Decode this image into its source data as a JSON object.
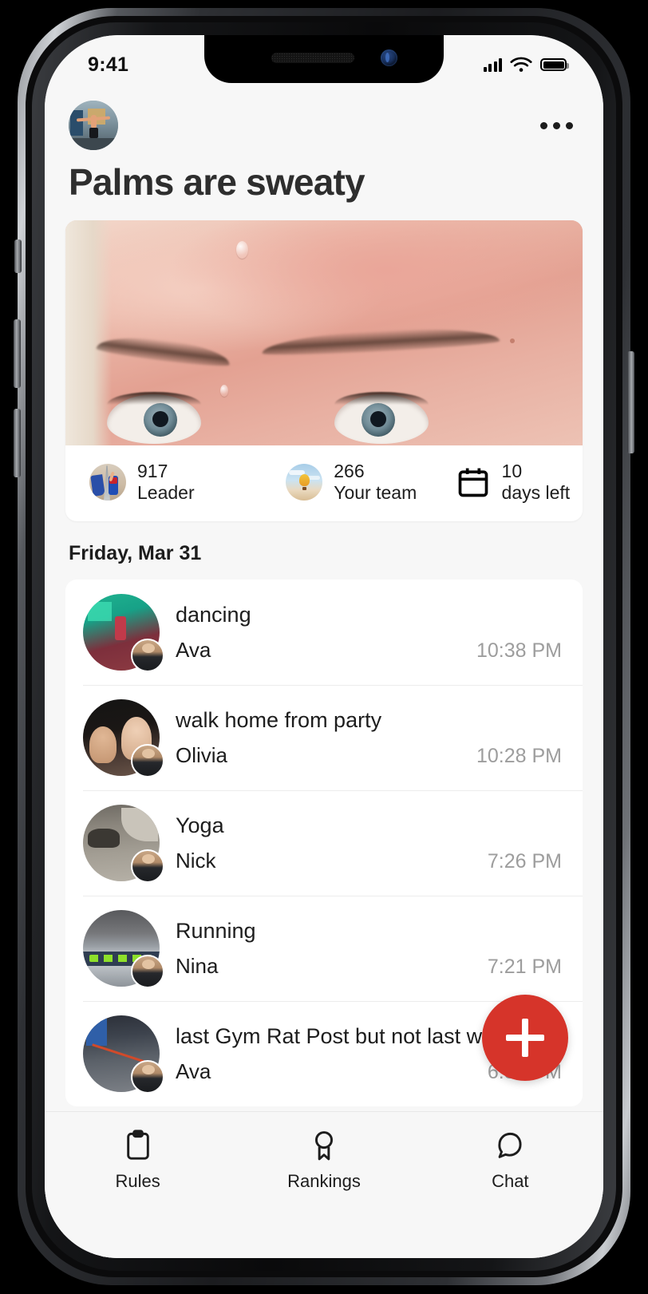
{
  "status_bar": {
    "time": "9:41",
    "signal_icon": "cellular-signal-icon",
    "wifi_icon": "wifi-icon",
    "battery_icon": "battery-full-icon"
  },
  "header": {
    "avatar_name": "group-avatar",
    "menu_icon": "more-options-icon",
    "title": "Palms are sweaty"
  },
  "hero": {
    "image_name": "sweaty-forehead-photo",
    "stats": [
      {
        "icon": "leader-avatar",
        "value": "917",
        "label": "Leader"
      },
      {
        "icon": "team-avatar",
        "value": "266",
        "label": "Your team"
      },
      {
        "icon": "calendar-icon",
        "value": "10",
        "label": "days left"
      }
    ]
  },
  "feed": {
    "date_header": "Friday, Mar 31",
    "items": [
      {
        "title": "dancing",
        "user": "Ava",
        "time": "10:38 PM",
        "photo": "pic-dance"
      },
      {
        "title": "walk home from party",
        "user": "Olivia",
        "time": "10:28 PM",
        "photo": "pic-walk"
      },
      {
        "title": "Yoga",
        "user": "Nick",
        "time": "7:26 PM",
        "photo": "pic-yoga"
      },
      {
        "title": "Running",
        "user": "Nina",
        "time": "7:21 PM",
        "photo": "pic-run"
      },
      {
        "title": "last Gym Rat Post but not last w",
        "user": "Ava",
        "time": "6:36 PM",
        "photo": "pic-gym"
      }
    ]
  },
  "fab": {
    "icon": "plus-icon",
    "color": "#d6342a"
  },
  "tabbar": {
    "tabs": [
      {
        "icon": "clipboard-icon",
        "label": "Rules"
      },
      {
        "icon": "award-ribbon-icon",
        "label": "Rankings"
      },
      {
        "icon": "chat-bubble-icon",
        "label": "Chat"
      }
    ]
  }
}
